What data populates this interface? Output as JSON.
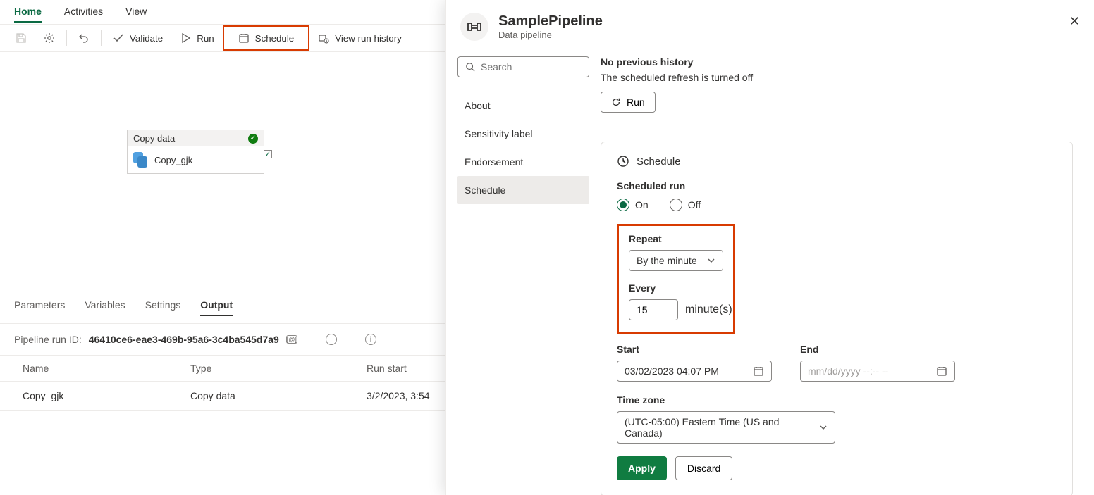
{
  "topTabs": {
    "home": "Home",
    "activities": "Activities",
    "view": "View"
  },
  "toolbar": {
    "validate": "Validate",
    "run": "Run",
    "schedule": "Schedule",
    "viewHistory": "View run history"
  },
  "activity": {
    "type": "Copy data",
    "name": "Copy_gjk"
  },
  "bottomTabs": {
    "parameters": "Parameters",
    "variables": "Variables",
    "settings": "Settings",
    "output": "Output"
  },
  "runId": {
    "label": "Pipeline run ID:",
    "value": "46410ce6-eae3-469b-95a6-3c4ba545d7a9",
    "badge": "[@]"
  },
  "outTable": {
    "headers": {
      "name": "Name",
      "type": "Type",
      "start": "Run start"
    },
    "row": {
      "name": "Copy_gjk",
      "type": "Copy data",
      "start": "3/2/2023, 3:54"
    }
  },
  "panel": {
    "title": "SamplePipeline",
    "subtitle": "Data pipeline",
    "searchPlaceholder": "Search",
    "nav": {
      "about": "About",
      "sensitivity": "Sensitivity label",
      "endorsement": "Endorsement",
      "schedule": "Schedule"
    },
    "history": {
      "none": "No previous history",
      "off": "The scheduled refresh is turned off",
      "run": "Run"
    },
    "sched": {
      "title": "Schedule",
      "runLabel": "Scheduled run",
      "on": "On",
      "off": "Off",
      "repeat": "Repeat",
      "repeatValue": "By the minute",
      "every": "Every",
      "everyValue": "15",
      "everyUnit": "minute(s)",
      "start": "Start",
      "startValue": "03/02/2023 04:07 PM",
      "end": "End",
      "endPlaceholder": "mm/dd/yyyy --:-- --",
      "tz": "Time zone",
      "tzValue": "(UTC-05:00) Eastern Time (US and Canada)",
      "apply": "Apply",
      "discard": "Discard"
    }
  }
}
